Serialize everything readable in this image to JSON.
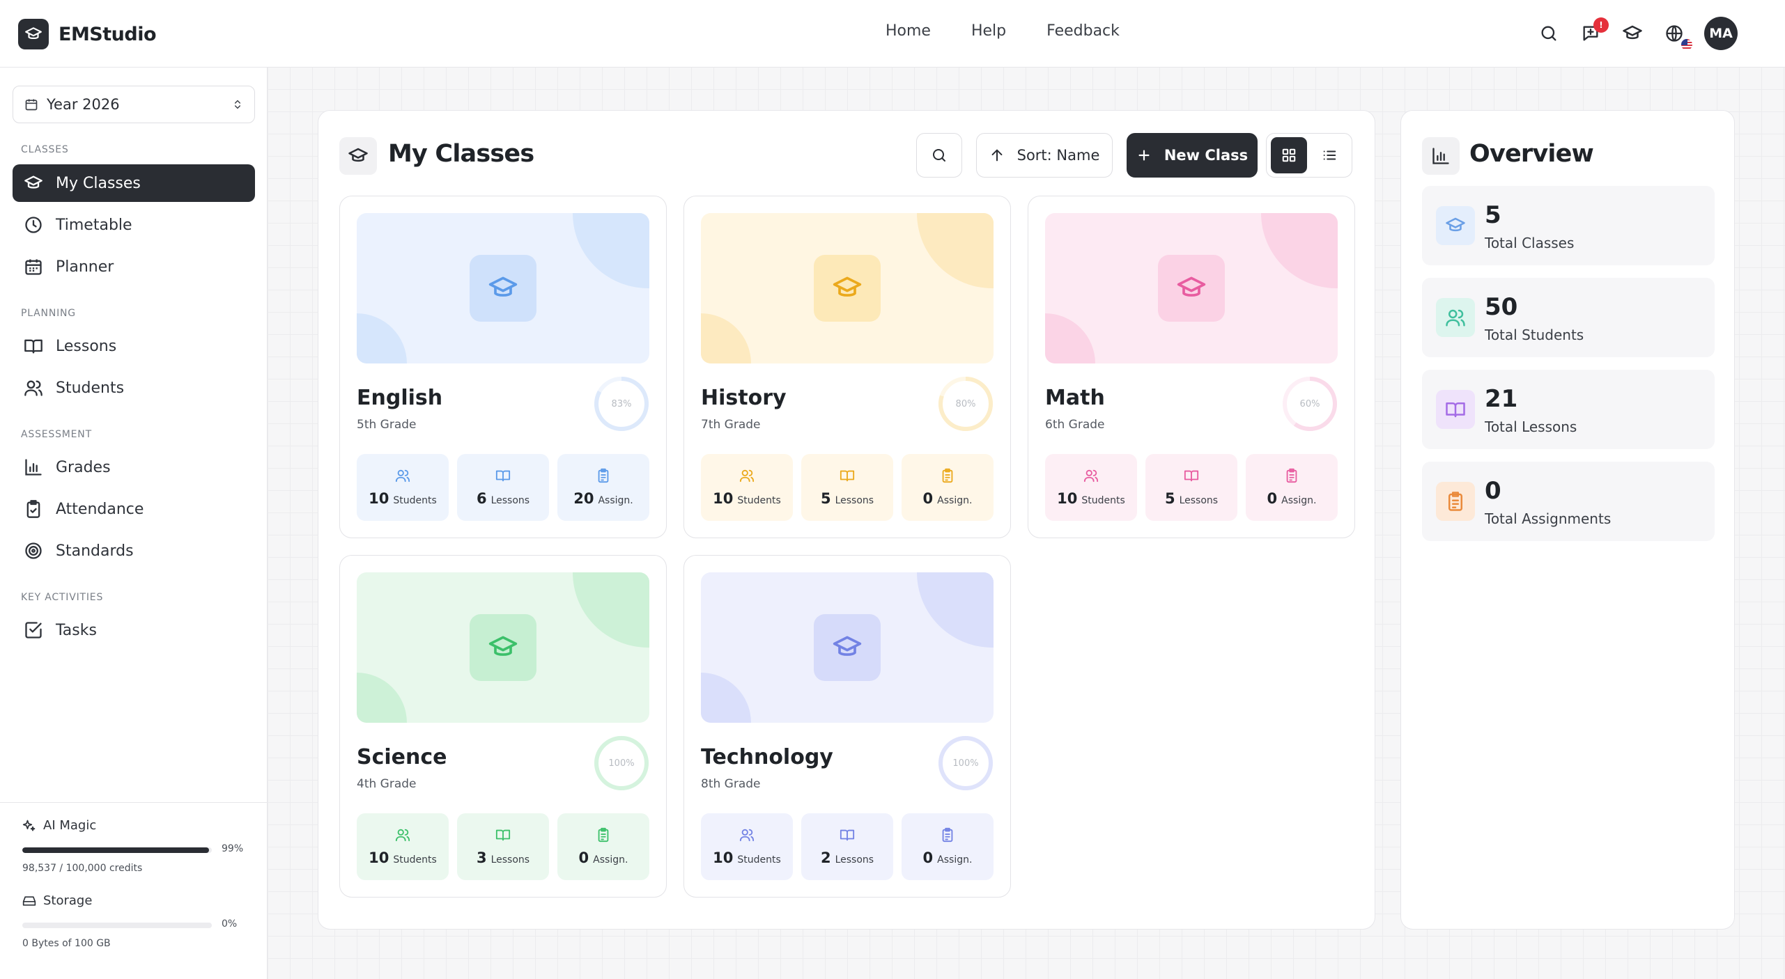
{
  "app": {
    "name": "EMStudio"
  },
  "topnav": [
    "Home",
    "Help",
    "Feedback"
  ],
  "header": {
    "notification_badge": "!",
    "avatar_initials": "MA"
  },
  "sidebar": {
    "year": "Year 2026",
    "sections": {
      "classes": "CLASSES",
      "planning": "PLANNING",
      "assessment": "ASSESSMENT",
      "key_activities": "KEY ACTIVITIES"
    },
    "items": {
      "my_classes": "My Classes",
      "timetable": "Timetable",
      "planner": "Planner",
      "lessons": "Lessons",
      "students": "Students",
      "grades": "Grades",
      "attendance": "Attendance",
      "standards": "Standards",
      "tasks": "Tasks"
    },
    "ai_magic": {
      "label": "AI Magic",
      "percent_text": "99%",
      "fraction": 0.985,
      "credits": "98,537 / 100,000 credits"
    },
    "storage": {
      "label": "Storage",
      "percent_text": "0%",
      "fraction": 0,
      "usage": "0 Bytes of 100 GB"
    }
  },
  "classes_panel": {
    "title": "My Classes",
    "sort_label": "Sort: Name",
    "new_class_label": "New Class"
  },
  "classes": [
    {
      "name": "English",
      "grade": "5th Grade",
      "progress_text": "83%",
      "progress": 0.83,
      "students": "10",
      "lessons": "6",
      "assignments": "20",
      "colors": {
        "bg": "#ebf2fe",
        "blob": "#d6e6fc",
        "accent": "#5b9ae9",
        "cap": "#cfe1fb",
        "stat": "#eef4fd",
        "ring": "#dde9fb"
      }
    },
    {
      "name": "History",
      "grade": "7th Grade",
      "progress_text": "80%",
      "progress": 0.8,
      "students": "10",
      "lessons": "5",
      "assignments": "0",
      "colors": {
        "bg": "#fff6e2",
        "blob": "#fdeac0",
        "accent": "#eba91c",
        "cap": "#fde9b8",
        "stat": "#fff7e8",
        "ring": "#fcedc9"
      }
    },
    {
      "name": "Math",
      "grade": "6th Grade",
      "progress_text": "60%",
      "progress": 0.6,
      "students": "10",
      "lessons": "5",
      "assignments": "0",
      "colors": {
        "bg": "#fdeaf3",
        "blob": "#fbd4e6",
        "accent": "#e85ca0",
        "cap": "#fbd2e5",
        "stat": "#fdeff5",
        "ring": "#fadbea"
      }
    },
    {
      "name": "Science",
      "grade": "4th Grade",
      "progress_text": "100%",
      "progress": 1.0,
      "students": "10",
      "lessons": "3",
      "assignments": "0",
      "colors": {
        "bg": "#e8f8ec",
        "blob": "#cdf1d7",
        "accent": "#3cc06a",
        "cap": "#c6efd2",
        "stat": "#ebf8ef",
        "ring": "#d5f3de"
      }
    },
    {
      "name": "Technology",
      "grade": "8th Grade",
      "progress_text": "100%",
      "progress": 1.0,
      "students": "10",
      "lessons": "2",
      "assignments": "0",
      "colors": {
        "bg": "#eef0fd",
        "blob": "#dadffb",
        "accent": "#7282e4",
        "cap": "#d6dbfa",
        "stat": "#f0f2fd",
        "ring": "#dfe3fb"
      }
    }
  ],
  "stat_units": {
    "students": "Students",
    "lessons": "Lessons",
    "assignments": "Assign."
  },
  "overview": {
    "title": "Overview",
    "items": [
      {
        "value": "5",
        "label": "Total Classes",
        "icon": "graduation-cap-icon",
        "color": "#6a9fe6",
        "bg": "#e4eefc"
      },
      {
        "value": "50",
        "label": "Total Students",
        "icon": "users-icon",
        "color": "#3fbf9d",
        "bg": "#ddf5ee"
      },
      {
        "value": "21",
        "label": "Total Lessons",
        "icon": "book-icon",
        "color": "#a46be6",
        "bg": "#efe3fb"
      },
      {
        "value": "0",
        "label": "Total Assignments",
        "icon": "clipboard-icon",
        "color": "#ea8a3b",
        "bg": "#fde9d8"
      }
    ]
  }
}
